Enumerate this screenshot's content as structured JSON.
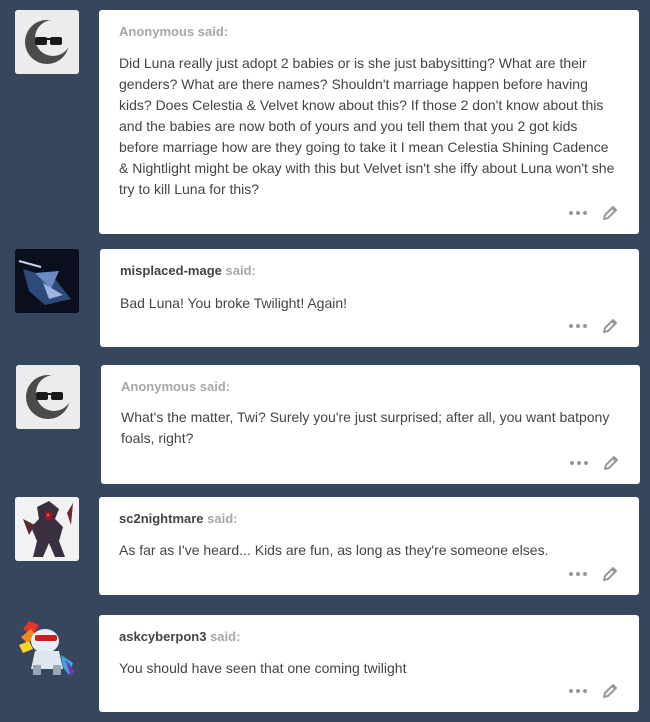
{
  "posts": [
    {
      "asker": "Anonymous",
      "said": "said:",
      "body": "Did Luna really just adopt 2 babies or is she just babysitting? What are their genders? What are there names? Shouldn't marriage happen before having kids? Does Celestia & Velvet know about this? If those 2 don't know about this and the babies are now both of yours and you tell them that you 2 got kids before marriage how are they going to take it I mean Celestia Shining Cadence & Nightlight might be okay with this but Velvet isn't she iffy about Luna won't she try to kill Luna for this?",
      "avatar_icon": "anonymous-sunglasses-icon",
      "anonymous": true
    },
    {
      "asker": "misplaced-mage",
      "said": "said:",
      "body": "Bad Luna! You broke Twilight! Again!",
      "avatar_icon": "misplaced-mage-avatar",
      "anonymous": false
    },
    {
      "asker": "Anonymous",
      "said": "said:",
      "body": "What's the matter, Twi? Surely you're just surprised; after all, you want batpony foals, right?",
      "avatar_icon": "anonymous-sunglasses-icon",
      "anonymous": true
    },
    {
      "asker": "sc2nightmare",
      "said": "said:",
      "body": "As far as I've heard... Kids are fun, as long as they're someone elses.",
      "avatar_icon": "sc2nightmare-avatar",
      "anonymous": false
    },
    {
      "asker": "askcyberpon3",
      "said": "said:",
      "body": "You should have seen that one coming twilight",
      "avatar_icon": "askcyberpon3-avatar",
      "anonymous": false
    }
  ],
  "colors": {
    "background": "#36465d",
    "card": "#ffffff",
    "text": "#444444",
    "muted": "#a7a7a7"
  }
}
